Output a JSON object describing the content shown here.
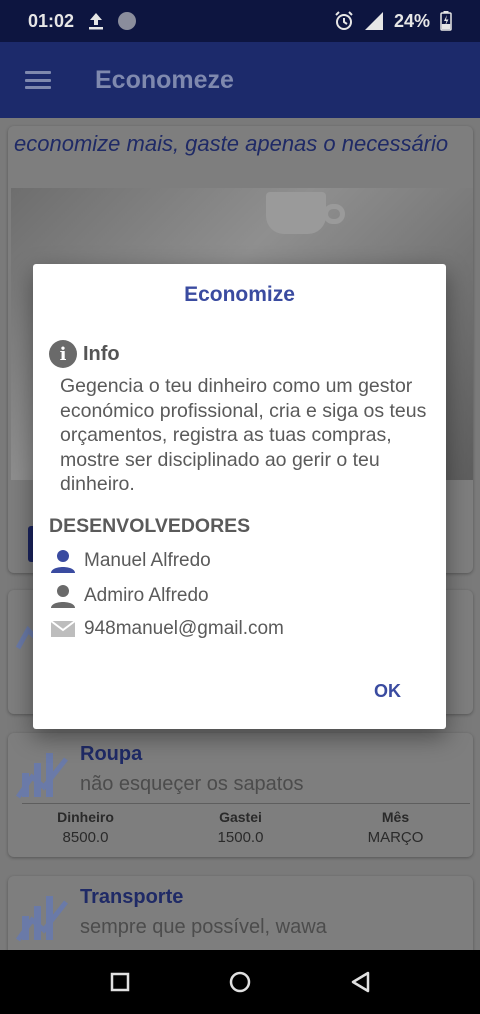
{
  "status_bar": {
    "time": "01:02",
    "battery": "24%"
  },
  "app_bar": {
    "title": "Economeze"
  },
  "hero": {
    "caption": "economize mais, gaste apenas o necessário"
  },
  "budgets": [
    {
      "title": "Roupa",
      "subtitle": "não esqueçer os sapatos",
      "stats": [
        {
          "label": "Dinheiro",
          "value": "8500.0"
        },
        {
          "label": "Gastei",
          "value": "1500.0"
        },
        {
          "label": "Mês",
          "value": "MARÇO"
        }
      ]
    },
    {
      "title": "Transporte",
      "subtitle": "sempre que possível, wawa"
    }
  ],
  "dialog": {
    "title": "Economize",
    "info_label": "Info",
    "info_text": "Gegencia o teu dinheiro como um gestor económico profissional, cria e siga os teus orçamentos, registra as tuas compras, mostre ser disciplinado ao gerir o teu dinheiro.",
    "developers_heading": "DESENVOLVEDORES",
    "developers": [
      {
        "name": "Manuel Alfredo",
        "icon": "person-icon",
        "color": "#3a4ba0"
      },
      {
        "name": "Admiro Alfredo",
        "icon": "person-icon",
        "color": "#6a6a6a"
      }
    ],
    "email": "948manuel@gmail.com",
    "ok_label": "OK"
  },
  "colors": {
    "primary": "#1c2a6b",
    "accent": "#3a4ba0",
    "status_bar": "#0d1540"
  }
}
